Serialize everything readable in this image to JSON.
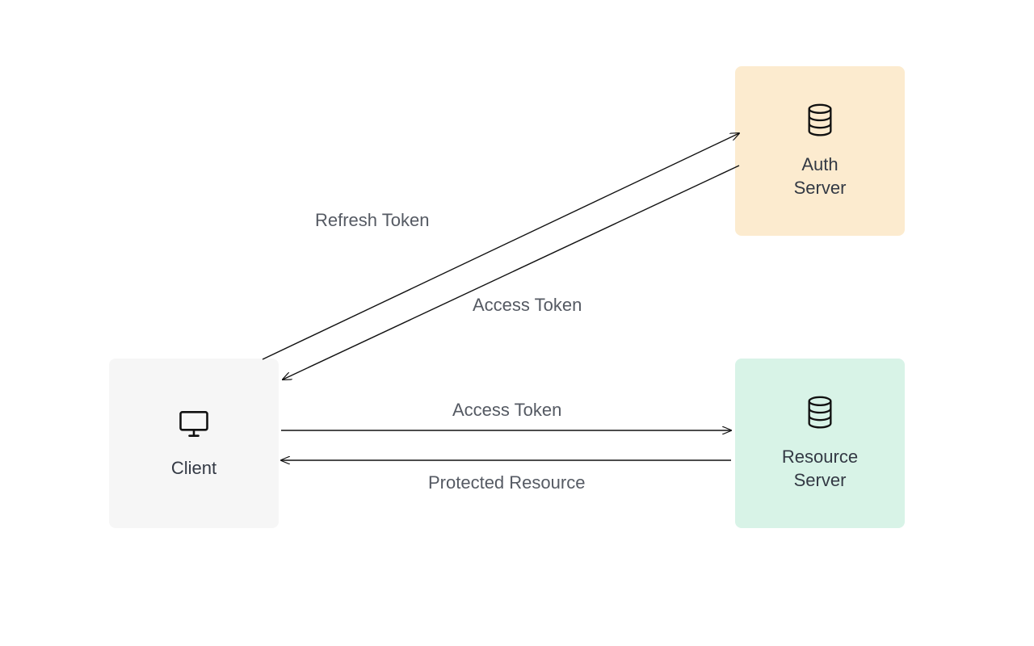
{
  "nodes": {
    "client": {
      "label": "Client",
      "icon": "monitor"
    },
    "auth": {
      "label": "Auth\nServer",
      "icon": "database"
    },
    "resource": {
      "label": "Resource\nServer",
      "icon": "database"
    }
  },
  "edges": {
    "refresh_token": {
      "label": "Refresh Token",
      "from": "client",
      "to": "auth"
    },
    "access_token_return": {
      "label": "Access Token",
      "from": "auth",
      "to": "client"
    },
    "access_token_send": {
      "label": "Access Token",
      "from": "client",
      "to": "resource"
    },
    "protected_resource": {
      "label": "Protected Resource",
      "from": "resource",
      "to": "client"
    }
  }
}
